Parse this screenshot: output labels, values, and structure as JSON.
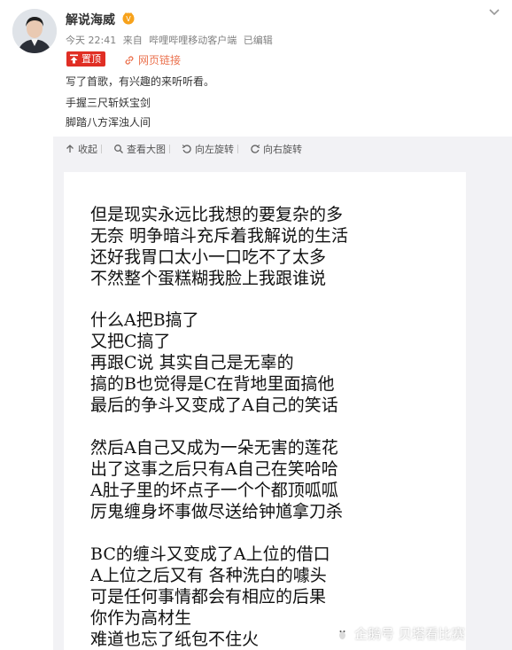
{
  "user": {
    "name": "解说海威"
  },
  "meta": {
    "time": "今天 22:41",
    "source_prefix": "来自",
    "source": "哔哩哔哩移动客户端",
    "edited": "已编辑"
  },
  "badges": {
    "pinned": "置顶",
    "web_link": "网页链接"
  },
  "post": {
    "lines": [
      "写了首歌，有兴趣的来听听看。",
      "手握三尺斩妖宝剑",
      "脚踏八方浑浊人间"
    ]
  },
  "toolbar": {
    "collapse": "收起",
    "view_large": "查看大图",
    "rotate_left": "向左旋转",
    "rotate_right": "向右旋转"
  },
  "lyrics": {
    "stanzas": [
      [
        "但是现实永远比我想的要复杂的多",
        "无奈 明争暗斗充斥着我解说的生活",
        "还好我胃口太小一口吃不了太多",
        "不然整个蛋糕糊我脸上我跟谁说"
      ],
      [
        "什么A把B搞了",
        "又把C搞了",
        "再跟C说 其实自己是无辜的",
        "搞的B也觉得是C在背地里面搞他",
        "最后的争斗又变成了A自己的笑话"
      ],
      [
        "然后A自己又成为一朵无害的莲花",
        "出了这事之后只有A自己在笑哈哈",
        "A肚子里的坏点子一个个都顶呱呱",
        "厉鬼缠身坏事做尽送给钟馗拿刀杀"
      ],
      [
        "BC的缠斗又变成了A上位的借口",
        "A上位之后又有 各种洗白的噱头",
        "可是任何事情都会有相应的后果",
        "你作为高材生",
        "难道也忘了纸包不住火"
      ]
    ]
  },
  "watermark": {
    "text": "企鹅号 贝塔看比赛"
  },
  "colors": {
    "pin": "#e02e24",
    "link": "#eb7350",
    "panel": "#f2f2f5"
  }
}
